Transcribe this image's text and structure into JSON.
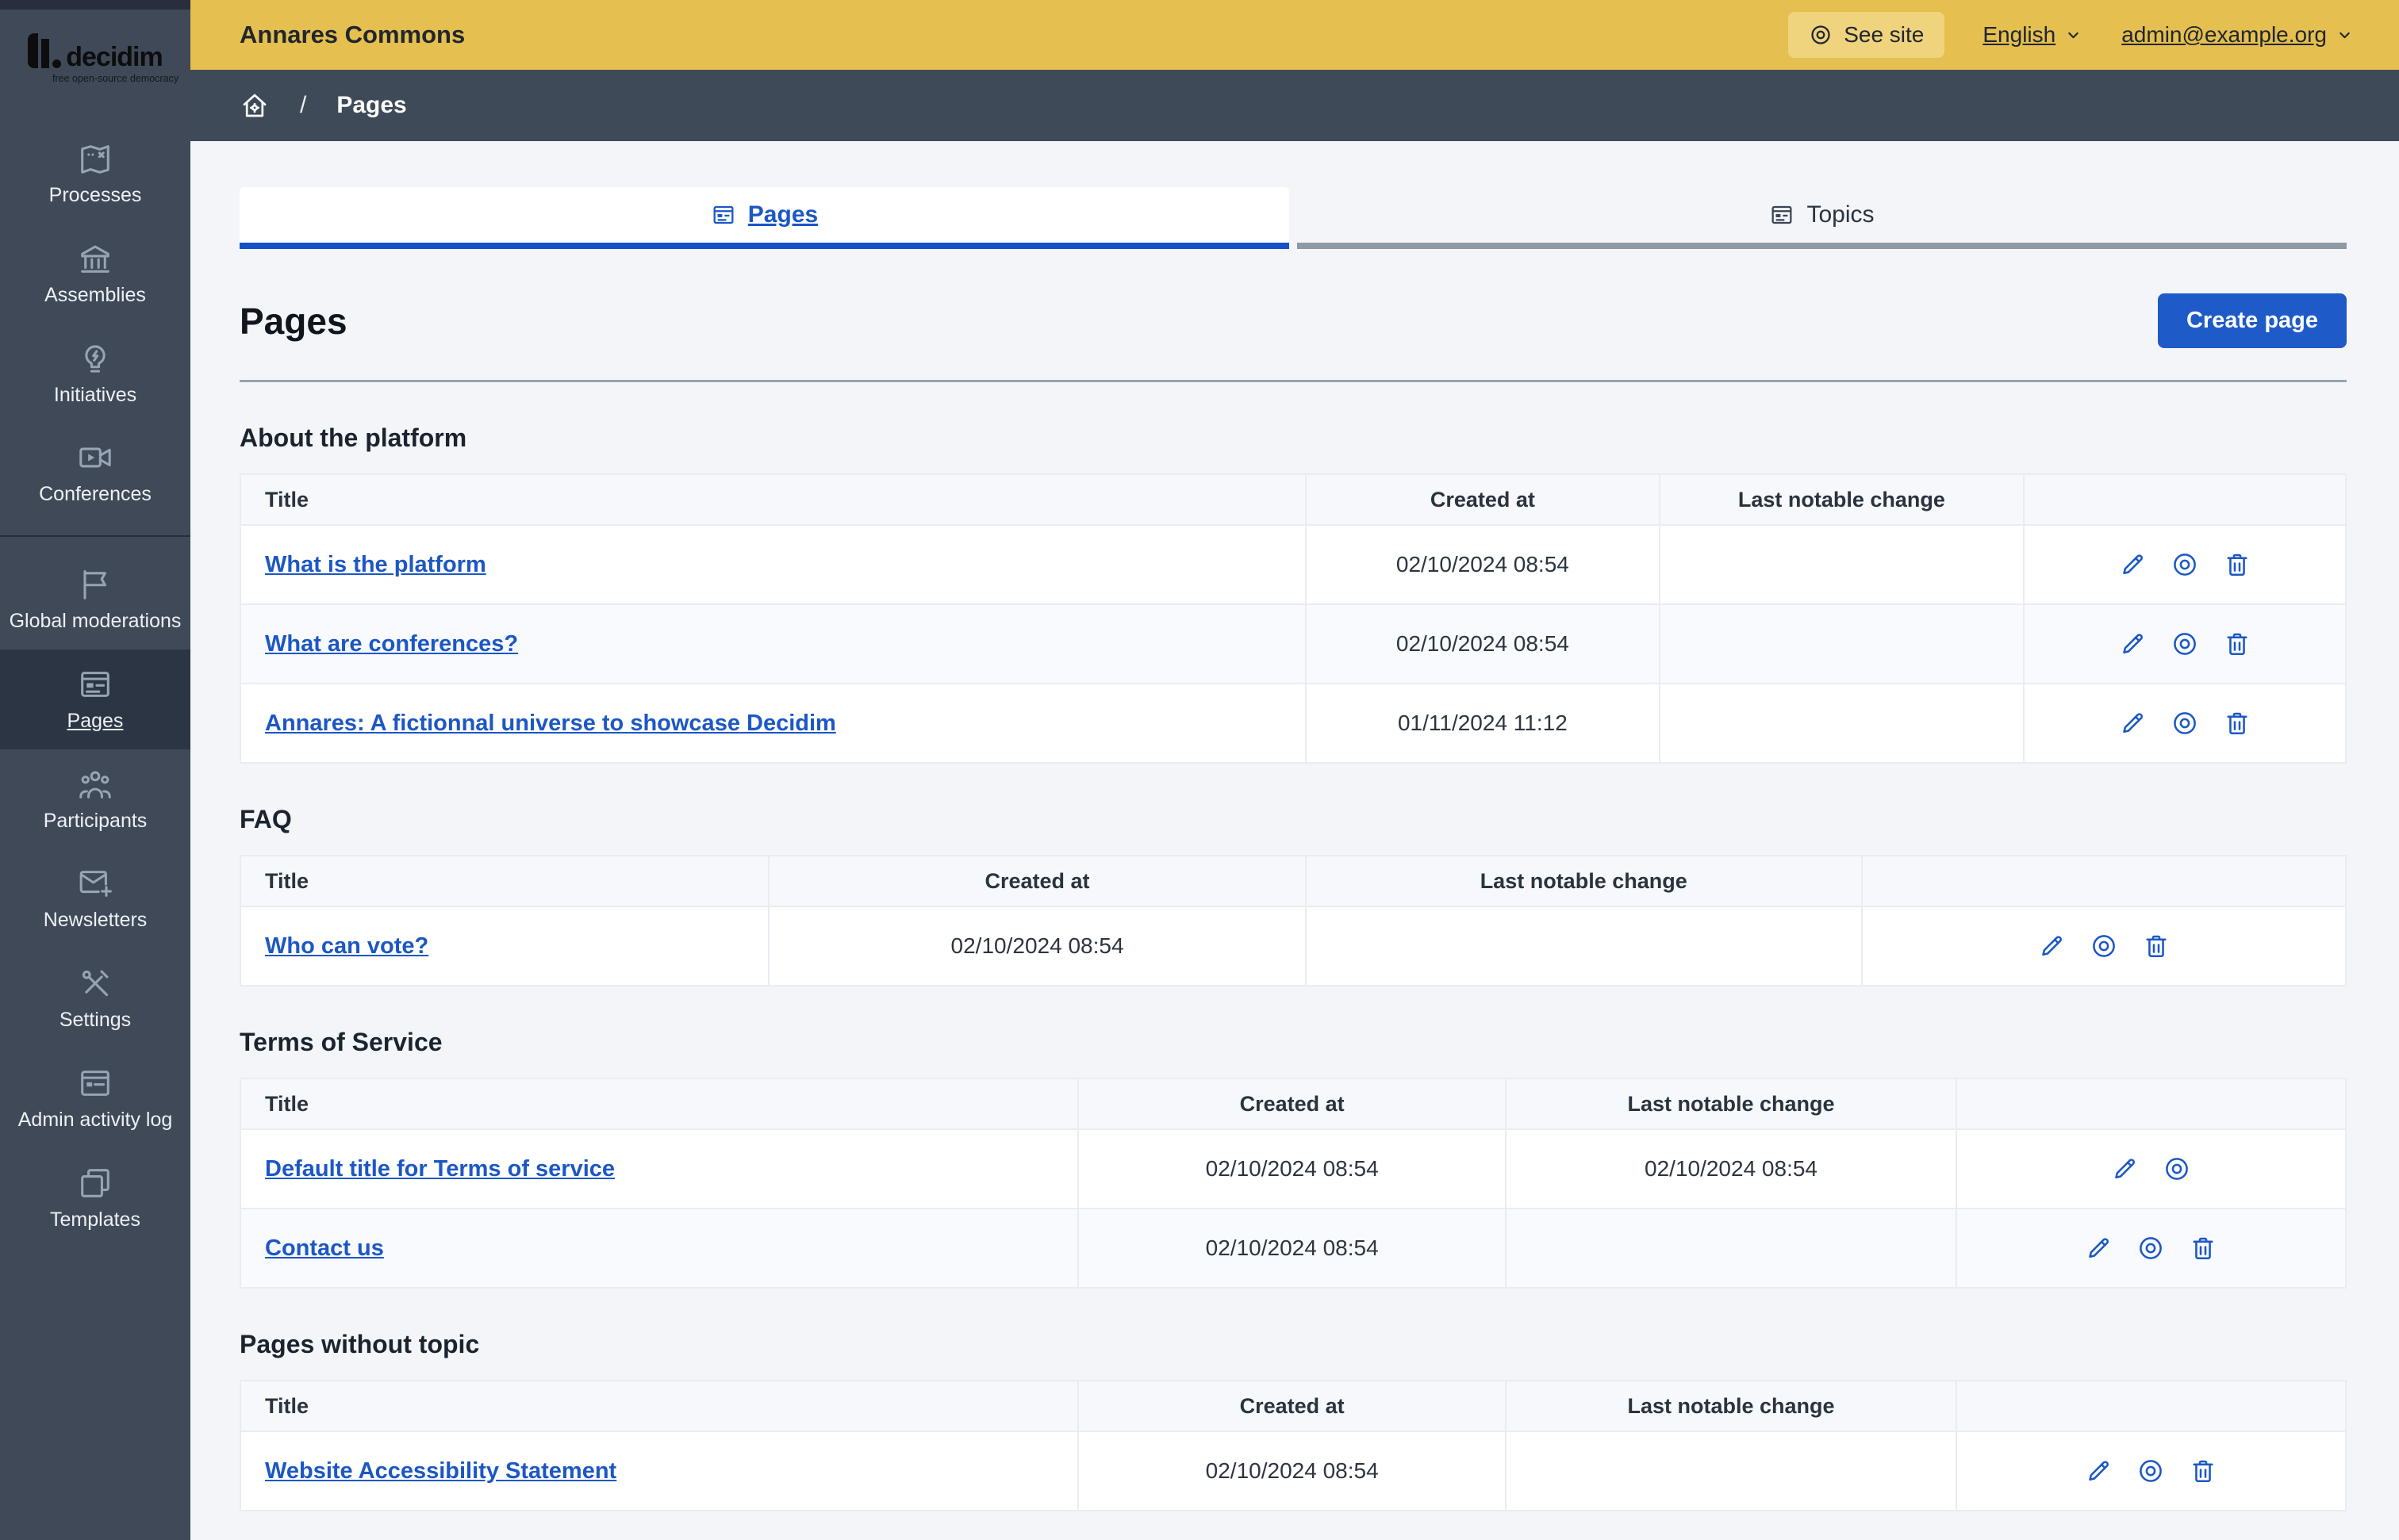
{
  "topbar": {
    "organization": "Annares Commons",
    "see_site": "See site",
    "language": "English",
    "user_email": "admin@example.org"
  },
  "logo": {
    "brand": "decidim",
    "tagline": "free open-source democracy"
  },
  "breadcrumb": {
    "separator": "/",
    "current": "Pages"
  },
  "sidebar": {
    "active": "pages",
    "groups": [
      [
        {
          "id": "processes",
          "label": "Processes",
          "icon": "map"
        },
        {
          "id": "assemblies",
          "label": "Assemblies",
          "icon": "bank"
        },
        {
          "id": "initiatives",
          "label": "Initiatives",
          "icon": "lightbulb"
        },
        {
          "id": "conferences",
          "label": "Conferences",
          "icon": "video"
        }
      ],
      [
        {
          "id": "global-moderations",
          "label": "Global moderations",
          "icon": "flag"
        },
        {
          "id": "pages",
          "label": "Pages",
          "icon": "pages"
        },
        {
          "id": "participants",
          "label": "Participants",
          "icon": "team"
        },
        {
          "id": "newsletters",
          "label": "Newsletters",
          "icon": "mail-add"
        },
        {
          "id": "settings",
          "label": "Settings",
          "icon": "tools"
        },
        {
          "id": "admin-activity-log",
          "label": "Admin activity log",
          "icon": "window"
        },
        {
          "id": "templates",
          "label": "Templates",
          "icon": "copy"
        }
      ]
    ]
  },
  "tabs": [
    {
      "id": "pages",
      "label": "Pages",
      "active": true
    },
    {
      "id": "topics",
      "label": "Topics",
      "active": false
    }
  ],
  "page": {
    "title": "Pages",
    "create_button": "Create page"
  },
  "sections": [
    {
      "heading": "About the platform",
      "columns": [
        "Title",
        "Created at",
        "Last notable change"
      ],
      "col_widths": [
        50.6,
        16.8,
        17.3,
        15.3
      ],
      "rows": [
        {
          "title": "What is the platform",
          "created_at": "02/10/2024 08:54",
          "last_change": "",
          "actions": [
            "edit",
            "preview",
            "delete"
          ]
        },
        {
          "title": "What are conferences?",
          "created_at": "02/10/2024 08:54",
          "last_change": "",
          "actions": [
            "edit",
            "preview",
            "delete"
          ]
        },
        {
          "title": "Annares: A fictionnal universe to showcase Decidim",
          "created_at": "01/11/2024 11:12",
          "last_change": "",
          "actions": [
            "edit",
            "preview",
            "delete"
          ]
        }
      ]
    },
    {
      "heading": "FAQ",
      "columns": [
        "Title",
        "Created at",
        "Last notable change"
      ],
      "col_widths": [
        25.1,
        25.5,
        26.4,
        23.0
      ],
      "rows": [
        {
          "title": "Who can vote?",
          "created_at": "02/10/2024 08:54",
          "last_change": "",
          "actions": [
            "edit",
            "preview",
            "delete"
          ]
        }
      ]
    },
    {
      "heading": "Terms of Service",
      "columns": [
        "Title",
        "Created at",
        "Last notable change"
      ],
      "col_widths": [
        39.8,
        20.3,
        21.4,
        18.5
      ],
      "rows": [
        {
          "title": "Default title for Terms of service",
          "created_at": "02/10/2024 08:54",
          "last_change": "02/10/2024 08:54",
          "actions": [
            "edit",
            "preview"
          ]
        },
        {
          "title": "Contact us",
          "created_at": "02/10/2024 08:54",
          "last_change": "",
          "actions": [
            "edit",
            "preview",
            "delete"
          ]
        }
      ]
    },
    {
      "heading": "Pages without topic",
      "columns": [
        "Title",
        "Created at",
        "Last notable change"
      ],
      "col_widths": [
        39.8,
        20.3,
        21.4,
        18.5
      ],
      "rows": [
        {
          "title": "Website Accessibility Statement",
          "created_at": "02/10/2024 08:54",
          "last_change": "",
          "actions": [
            "edit",
            "preview",
            "delete"
          ]
        }
      ]
    }
  ],
  "colors": {
    "topbar_yellow": "#e5bf4f",
    "see_site_chip": "#efd37d",
    "sidebar": "#3f4958",
    "sidebar_active": "#2c3543",
    "breadcrumb": "#3f4a59",
    "page_bg": "#f3f5f9",
    "accent_blue": "#1c57c5",
    "button_blue": "#1e5bc8",
    "tab_underline_active": "#1552c8",
    "tab_underline_inactive": "#8f99a5",
    "table_border": "#e7edf4",
    "table_header_bg": "#f6f8fb",
    "row_alt_bg": "#f8fafd",
    "text_dark": "#20262e"
  }
}
